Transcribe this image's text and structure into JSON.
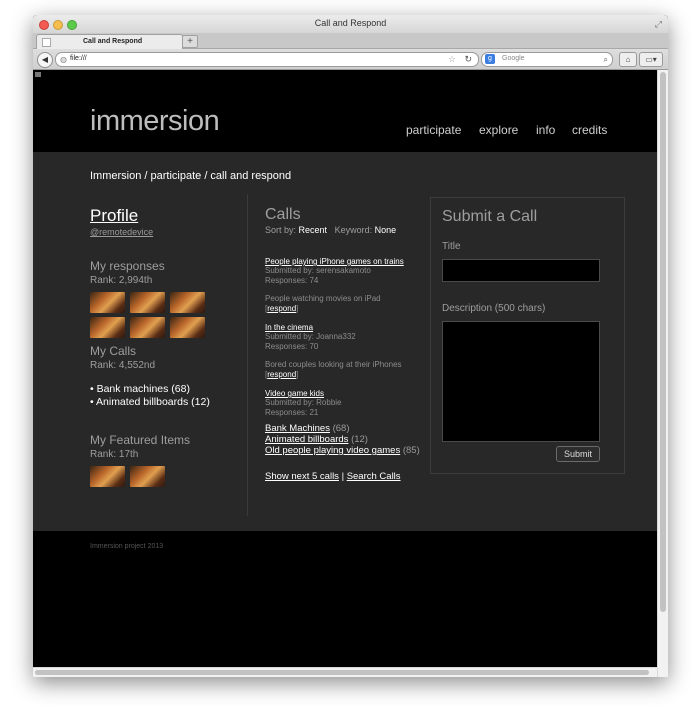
{
  "window": {
    "title": "Call and Respond",
    "tab_label": "Call and Respond",
    "url": "file:///",
    "search_placeholder": "Google"
  },
  "site": {
    "logo": "immersion",
    "nav": [
      "participate",
      "explore",
      "info",
      "credits"
    ],
    "breadcrumb": "Immersion / participate / call and respond",
    "footer": "Immersion project 2013"
  },
  "profile": {
    "title": "Profile",
    "handle": "@remotedevice",
    "responses_title": "My responses",
    "responses_rank": "Rank: 2,994th",
    "calls_title": "My Calls",
    "calls_rank": "Rank: 4,552nd",
    "my_calls": [
      "• Bank machines (68)",
      "• Animated billboards (12)"
    ],
    "featured_title": "My Featured Items",
    "featured_rank": "Rank: 17th"
  },
  "calls": {
    "title": "Calls",
    "sort_prefix": "Sort by:",
    "sort_value": "Recent",
    "keyword_prefix": "Keyword:",
    "keyword_value": "None",
    "items": [
      {
        "title": "People playing iPhone games on trains",
        "submitted": "Submitted by: serensakamoto",
        "responses": "Responses: 74"
      },
      {
        "desc": "People watching movies on iPad",
        "respond": "respond"
      },
      {
        "title": "In the cinema",
        "submitted": "Submitted by: Joanna332",
        "responses": "Responses: 70"
      },
      {
        "desc": "Bored couples looking at their iPhones",
        "respond": "respond"
      },
      {
        "title": "Video game kids",
        "submitted": "Submitted by: Robbie",
        "responses": "Responses: 21"
      }
    ],
    "keywords": [
      {
        "label": "Bank Machines",
        "count": "(68)"
      },
      {
        "label": "Animated billboards",
        "count": "(12)"
      },
      {
        "label": "Old people playing video games",
        "count": "(85)"
      }
    ],
    "next_link": "Show next 5 calls",
    "separator": "|",
    "search_link": "Search Calls"
  },
  "submit": {
    "title": "Submit a Call",
    "title_label": "Title",
    "desc_label": "Description (500 chars)",
    "button": "Submit"
  }
}
